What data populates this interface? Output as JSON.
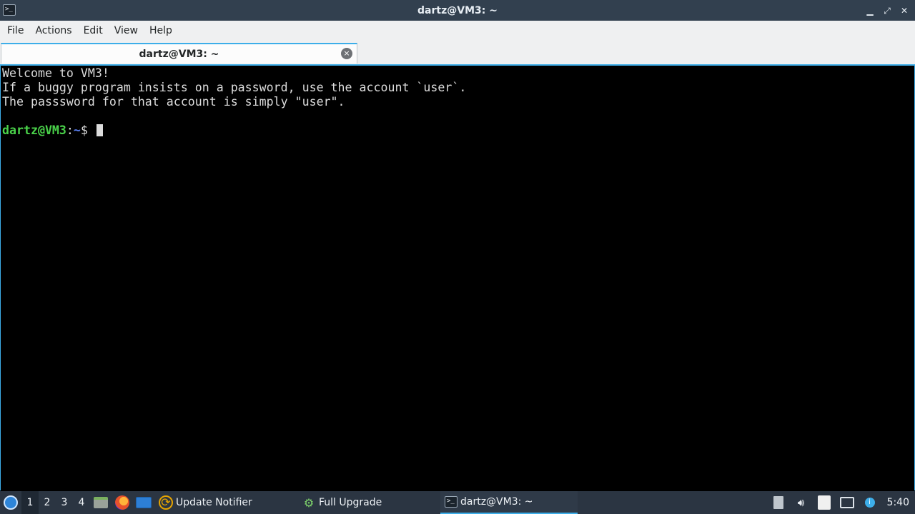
{
  "window": {
    "title": "dartz@VM3: ~",
    "app_icon": "terminal-icon",
    "minimize_glyph": "▁",
    "maximize_glyph": "⤢",
    "close_glyph": "✕"
  },
  "menu": [
    "File",
    "Actions",
    "Edit",
    "View",
    "Help"
  ],
  "tab": {
    "label": "dartz@VM3: ~",
    "close_glyph": "×"
  },
  "terminal": {
    "lines": [
      "Welcome to VM3!",
      "If a buggy program insists on a password, use the account `user`.",
      "The passsword for that account is simply \"user\".",
      ""
    ],
    "prompt_user": "dartz@VM3",
    "prompt_sep": ":",
    "prompt_path": "~",
    "prompt_symbol": "$ "
  },
  "taskbar": {
    "desktops": [
      "1",
      "2",
      "3",
      "4"
    ],
    "active_desktop": "1",
    "tasks": [
      {
        "label": "Update Notifier",
        "icon": "update-notifier-icon"
      },
      {
        "label": "Full Upgrade",
        "icon": "gear-icon"
      },
      {
        "label": "dartz@VM3: ~",
        "icon": "terminal-icon"
      }
    ],
    "clock": "5:40",
    "accent": "#3daee9"
  }
}
